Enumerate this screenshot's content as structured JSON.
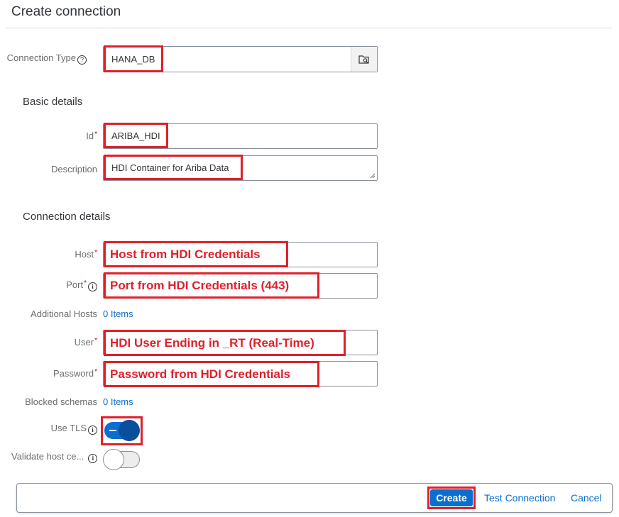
{
  "title": "Create connection",
  "connection_type": {
    "label": "Connection Type",
    "value": "HANA_DB"
  },
  "basic_details": {
    "heading": "Basic details",
    "id": {
      "label": "Id",
      "value": "ARIBA_HDI"
    },
    "description": {
      "label": "Description",
      "value": "HDI Container for Ariba Data"
    }
  },
  "connection_details": {
    "heading": "Connection details",
    "host": {
      "label": "Host",
      "value": "Host from HDI Credentials"
    },
    "port": {
      "label": "Port",
      "value": "Port from HDI Credentials (443)"
    },
    "additional_hosts": {
      "label": "Additional Hosts",
      "value": "0 Items"
    },
    "user": {
      "label": "User",
      "value": "HDI User Ending in _RT (Real-Time)"
    },
    "password": {
      "label": "Password",
      "value": "Password from HDI Credentials"
    },
    "blocked_schemas": {
      "label": "Blocked schemas",
      "value": "0 Items"
    },
    "use_tls": {
      "label": "Use TLS",
      "on": true
    },
    "validate_host": {
      "label": "Validate host ce...",
      "on": false
    }
  },
  "footer": {
    "create": "Create",
    "test": "Test Connection",
    "cancel": "Cancel"
  },
  "colors": {
    "accent": "#0a6ed1",
    "highlight": "#e0202a",
    "toggle_on": "#0a4f9e"
  }
}
